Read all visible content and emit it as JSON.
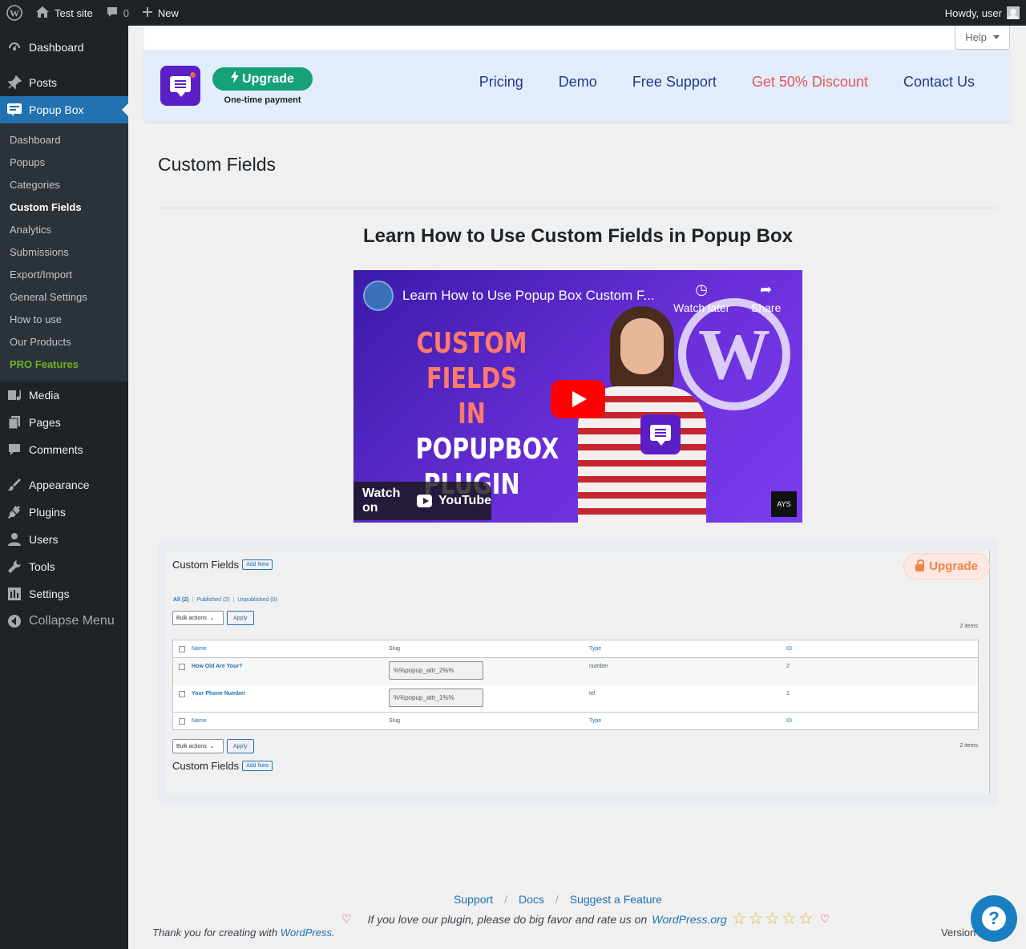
{
  "admin_bar": {
    "site_name": "Test site",
    "comments_count": "0",
    "new_label": "New",
    "howdy": "Howdy, user"
  },
  "sidebar": {
    "dashboard": "Dashboard",
    "posts": "Posts",
    "popup_box": "Popup Box",
    "submenu": [
      "Dashboard",
      "Popups",
      "Categories",
      "Custom Fields",
      "Analytics",
      "Submissions",
      "Export/Import",
      "General Settings",
      "How to use",
      "Our Products",
      "PRO Features"
    ],
    "media": "Media",
    "pages": "Pages",
    "comments": "Comments",
    "appearance": "Appearance",
    "plugins": "Plugins",
    "users": "Users",
    "tools": "Tools",
    "settings": "Settings",
    "collapse": "Collapse Menu"
  },
  "help_tab": "Help",
  "promo": {
    "upgrade": "Upgrade",
    "onetime": "One-time payment",
    "nav": [
      "Pricing",
      "Demo",
      "Free Support",
      "Get 50% Discount",
      "Contact Us"
    ],
    "discount_color": "#e85555"
  },
  "page_title": "Custom Fields",
  "section_title": "Learn How to Use Custom Fields in Popup Box",
  "video": {
    "title": "Learn How to Use Popup Box Custom F...",
    "watch_later": "Watch later",
    "share": "Share",
    "thumb_lines": [
      "CUSTOM",
      "FIELDS IN",
      "POPUPBOX",
      "PLUGIN"
    ],
    "watch_on": "Watch on",
    "youtube": "YouTube",
    "badge": "AYS"
  },
  "preview": {
    "title": "Custom Fields",
    "add_new": "Add New",
    "filter_all": "All (2)",
    "filter_published": "Published (2)",
    "filter_unpublished": "Unpublished (0)",
    "bulk_actions": "Bulk actions",
    "apply": "Apply",
    "items": "2 items",
    "columns": [
      "Name",
      "Slug",
      "Type",
      "ID"
    ],
    "rows": [
      {
        "name": "How Old Are Your?",
        "slug": "%%popup_attr_2%%",
        "type": "number",
        "id": "2"
      },
      {
        "name": "Your Phone Number",
        "slug": "%%popup_attr_1%%",
        "type": "tel",
        "id": "1"
      }
    ],
    "upgrade_badge": "Upgrade",
    "upgrade_color": "#f0824a"
  },
  "footer": {
    "support": "Support",
    "docs": "Docs",
    "suggest": "Suggest a Feature",
    "rate_text": "If you love our plugin, please do big favor and rate us on",
    "wporg": "WordPress.org",
    "thanks": "Thank you for creating with",
    "wordpress": "WordPress",
    "version": "Version"
  }
}
